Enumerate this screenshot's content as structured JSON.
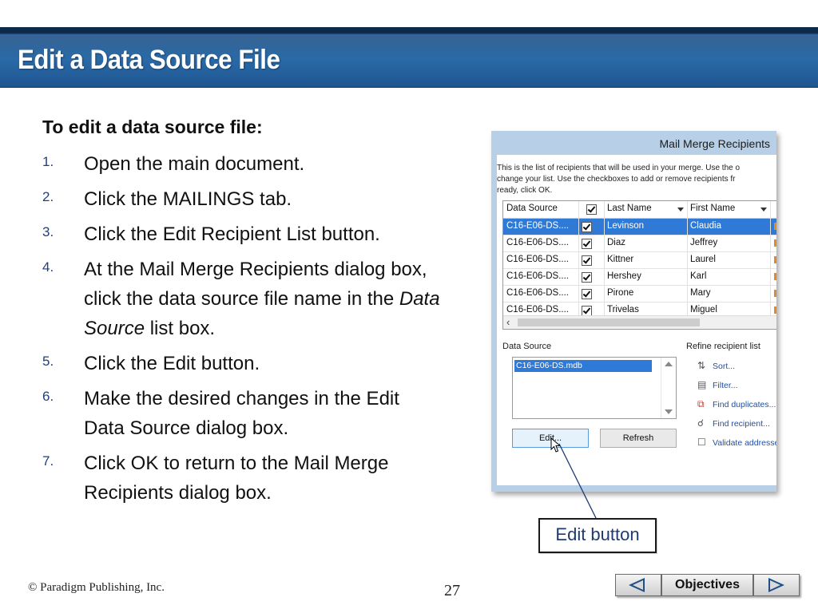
{
  "slide": {
    "title": "Edit a Data Source File",
    "intro": "To edit a data source file:",
    "steps": [
      {
        "num": "1.",
        "text": "Open the main document."
      },
      {
        "num": "2.",
        "text": "Click the MAILINGS tab."
      },
      {
        "num": "3.",
        "text": "Click the Edit Recipient List button."
      },
      {
        "num": "4.",
        "text_before": "At the Mail Merge Recipients dialog box, click the data source file name in the ",
        "text_italic": "Data Source",
        "text_after": " list box."
      },
      {
        "num": "5.",
        "text": "Click the Edit button."
      },
      {
        "num": "6.",
        "text": "Make the desired changes in the Edit Data Source dialog box."
      },
      {
        "num": "7.",
        "text": "Click OK to return to the Mail Merge Recipients dialog box."
      }
    ],
    "callout": "Edit button"
  },
  "dialog": {
    "title": "Mail Merge Recipients",
    "description": [
      "This is the list of recipients that will be used in your merge.  Use the o",
      "change your list.  Use the checkboxes to add or remove recipients fr",
      "ready, click OK."
    ],
    "columns": [
      "Data Source",
      "",
      "Last Name",
      "First Name"
    ],
    "rows": [
      {
        "source": "C16-E06-DS....",
        "last": "Levinson",
        "first": "Claudia",
        "selected": true
      },
      {
        "source": "C16-E06-DS....",
        "last": "Diaz",
        "first": "Jeffrey",
        "selected": false
      },
      {
        "source": "C16-E06-DS....",
        "last": "Kittner",
        "first": "Laurel",
        "selected": false
      },
      {
        "source": "C16-E06-DS....",
        "last": "Hershey",
        "first": "Karl",
        "selected": false
      },
      {
        "source": "C16-E06-DS....",
        "last": "Pirone",
        "first": "Mary",
        "selected": false
      },
      {
        "source": "C16-E06-DS....",
        "last": "Trivelas",
        "first": "Miguel",
        "selected": false
      }
    ],
    "data_source_label": "Data Source",
    "data_source_item": "C16-E06-DS.mdb",
    "refine_label": "Refine recipient list",
    "refine_items": [
      {
        "label": "Sort...",
        "icon": "sort-az-icon"
      },
      {
        "label": "Filter...",
        "icon": "filter-icon"
      },
      {
        "label": "Find duplicates...",
        "icon": "find-duplicates-icon"
      },
      {
        "label": "Find recipient...",
        "icon": "find-recipient-icon"
      },
      {
        "label": "Validate addresses...",
        "icon": "validate-address-icon"
      }
    ],
    "edit_button": "Edit...",
    "refresh_button": "Refresh"
  },
  "footer": {
    "copyright": "© Paradigm Publishing, Inc.",
    "page_number": "27",
    "objectives": "Objectives"
  },
  "colors": {
    "banner": "#2a6aa7",
    "selection": "#2f7ad6",
    "nav_arrow": "#1f4f86"
  }
}
